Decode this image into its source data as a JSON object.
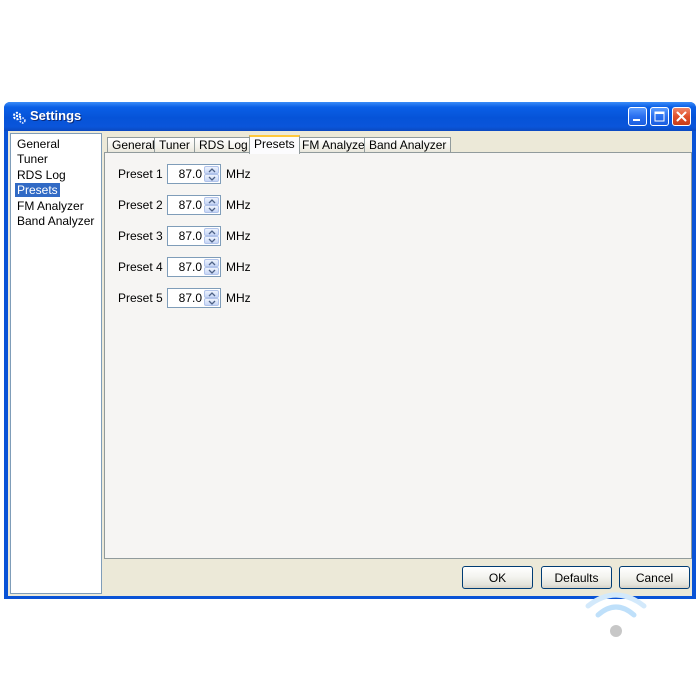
{
  "window": {
    "title": "Settings"
  },
  "sidebar": {
    "items": [
      {
        "label": "General"
      },
      {
        "label": "Tuner"
      },
      {
        "label": "RDS Log"
      },
      {
        "label": "Presets",
        "selected": true
      },
      {
        "label": "FM Analyzer"
      },
      {
        "label": "Band Analyzer"
      }
    ]
  },
  "tabs": [
    {
      "label": "General"
    },
    {
      "label": "Tuner"
    },
    {
      "label": "RDS Log"
    },
    {
      "label": "Presets",
      "active": true
    },
    {
      "label": "FM Analyzer"
    },
    {
      "label": "Band Analyzer"
    }
  ],
  "presets": [
    {
      "label": "Preset 1",
      "value": "87.0",
      "unit": "MHz"
    },
    {
      "label": "Preset 2",
      "value": "87.0",
      "unit": "MHz"
    },
    {
      "label": "Preset 3",
      "value": "87.0",
      "unit": "MHz"
    },
    {
      "label": "Preset 4",
      "value": "87.0",
      "unit": "MHz"
    },
    {
      "label": "Preset 5",
      "value": "87.0",
      "unit": "MHz"
    }
  ],
  "footer": {
    "ok_label": "OK",
    "defaults_label": "Defaults",
    "cancel_label": "Cancel"
  },
  "icons": {
    "title": "settings-gear-icon",
    "minimize": "minimize-icon",
    "maximize": "maximize-icon",
    "close": "close-icon",
    "spin_up": "chevron-up-icon",
    "spin_down": "chevron-down-icon",
    "watermark": "wifi-icon"
  },
  "colors": {
    "titlebar": "#0653d8",
    "selection": "#316ac5",
    "active_tab_accent": "#ffc83c",
    "close_button": "#e0502a"
  }
}
